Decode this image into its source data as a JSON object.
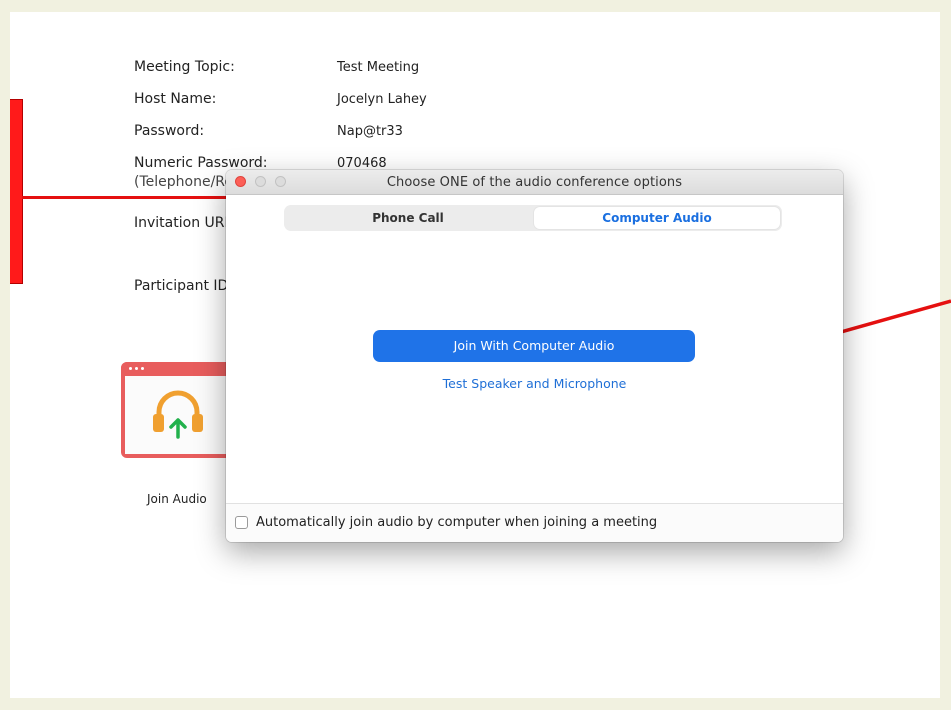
{
  "meeting_info": {
    "rows": [
      {
        "label": "Meeting Topic:",
        "value": "Test Meeting"
      },
      {
        "label": "Host Name:",
        "value": "Jocelyn Lahey"
      },
      {
        "label": "Password:",
        "value": "Nap@tr33"
      },
      {
        "label": "Numeric Password:",
        "value": "070468"
      }
    ],
    "numeric_password_sub": "(Telephone/Ro",
    "invitation_label": "Invitation URL",
    "participant_label": "Participant ID:"
  },
  "join_audio": {
    "label": "Join Audio",
    "icon": "headphones-icon",
    "colors": {
      "frame": "#e85d5d",
      "headphones": "#f0a030",
      "arrow": "#22b14c"
    }
  },
  "dialog": {
    "title": "Choose ONE of the audio conference options",
    "tabs": [
      {
        "label": "Phone Call",
        "selected": false
      },
      {
        "label": "Computer Audio",
        "selected": true
      }
    ],
    "primary_button": "Join With Computer Audio",
    "test_link": "Test Speaker and Microphone",
    "auto_join_label": "Automatically join audio by computer when joining a meeting",
    "auto_join_checked": false
  },
  "colors": {
    "accent": "#1f73e8",
    "annotation_red": "#e51010",
    "background": "#f1f1e0"
  }
}
